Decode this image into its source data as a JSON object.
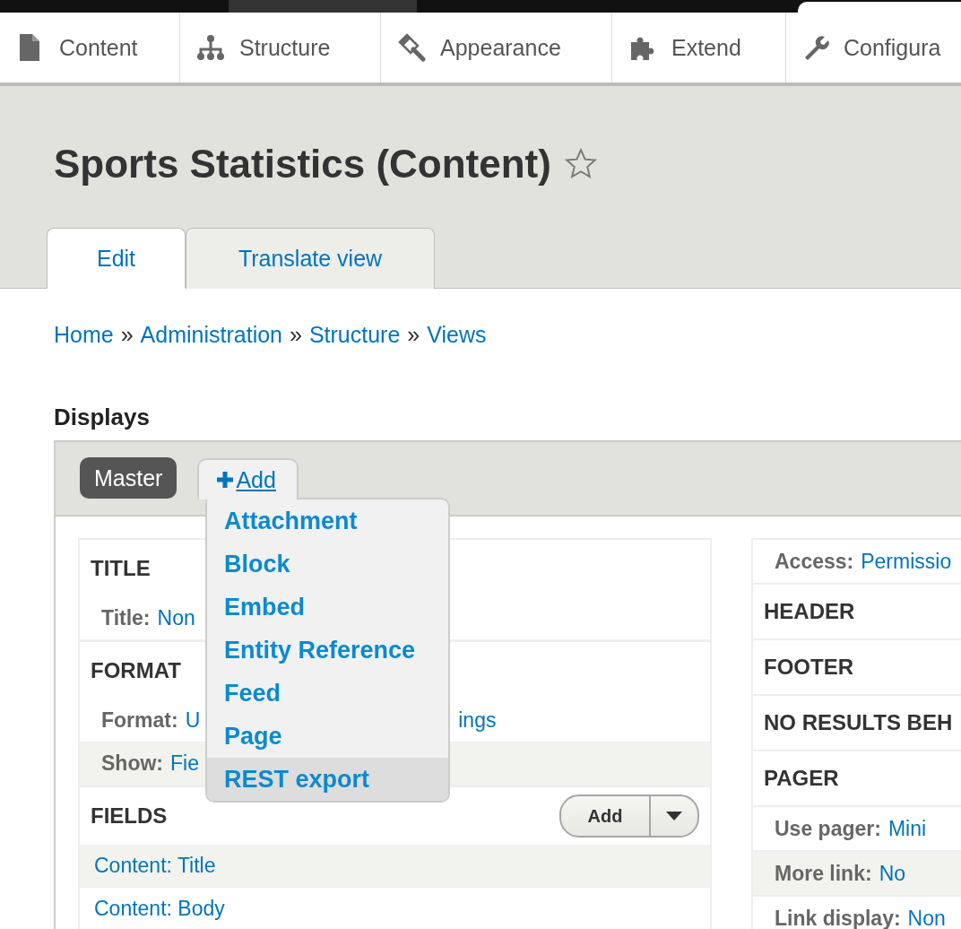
{
  "toolbar": {
    "items": [
      {
        "label": "Content"
      },
      {
        "label": "Structure"
      },
      {
        "label": "Appearance"
      },
      {
        "label": "Extend"
      },
      {
        "label": "Configura"
      }
    ]
  },
  "page_title": "Sports Statistics (Content)",
  "tabs": [
    {
      "label": "Edit",
      "selected": true
    },
    {
      "label": "Translate view",
      "selected": false
    }
  ],
  "breadcrumb": [
    {
      "kind": "link",
      "text": "Home"
    },
    {
      "kind": "separator",
      "text": "»"
    },
    {
      "kind": "link",
      "text": "Administration"
    },
    {
      "kind": "separator",
      "text": "»"
    },
    {
      "kind": "link",
      "text": "Structure"
    },
    {
      "kind": "separator",
      "text": "»"
    },
    {
      "kind": "link",
      "text": "Views"
    }
  ],
  "displays": {
    "heading": "Displays",
    "display_tabs": [
      {
        "label": "Master",
        "selected": true
      }
    ],
    "add_link": {
      "label": "Add",
      "expanded": true
    },
    "add_menu": [
      {
        "label": "Attachment",
        "selected": false
      },
      {
        "label": "Block",
        "selected": false
      },
      {
        "label": "Embed",
        "selected": false
      },
      {
        "label": "Entity Reference",
        "selected": false
      },
      {
        "label": "Feed",
        "selected": false
      },
      {
        "label": "Page",
        "selected": false
      },
      {
        "label": "REST export",
        "selected": true
      }
    ]
  },
  "left_column": [
    {
      "heading": "TITLE",
      "rows": [
        {
          "label": "Title:",
          "value": "Non",
          "shaded": false
        }
      ]
    },
    {
      "heading": "FORMAT",
      "rows": [
        {
          "label": "Format:",
          "value": "U",
          "value_tail": "ings",
          "shaded": false
        },
        {
          "label": "Show:",
          "value": "Fie",
          "shaded": true
        }
      ]
    },
    {
      "heading": "FIELDS",
      "button": {
        "label": "Add"
      },
      "rows": [
        {
          "value": "Content: Title",
          "shaded": true
        },
        {
          "value": "Content: Body",
          "shaded": false
        }
      ]
    }
  ],
  "right_column": [
    {
      "kind": "row",
      "label": "Access:",
      "value": "Permissio",
      "shaded": false
    },
    {
      "kind": "heading",
      "text": "HEADER"
    },
    {
      "kind": "heading",
      "text": "FOOTER"
    },
    {
      "kind": "heading",
      "text": "NO RESULTS BEH"
    },
    {
      "kind": "heading",
      "text": "PAGER"
    },
    {
      "kind": "row",
      "label": "Use pager:",
      "value": "Mini",
      "shaded": false
    },
    {
      "kind": "row",
      "label": "More link:",
      "value": "No",
      "shaded": true
    },
    {
      "kind": "row",
      "label": "Link display:",
      "value": "Non",
      "shaded": false
    }
  ]
}
